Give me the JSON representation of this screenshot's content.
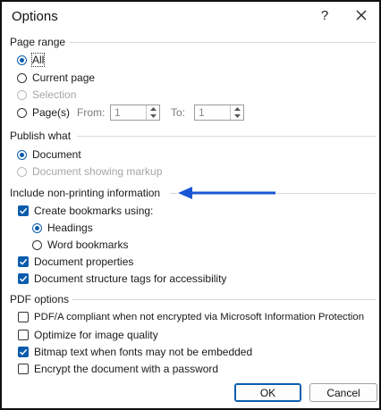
{
  "window": {
    "title": "Options",
    "help_glyph": "?"
  },
  "page_range": {
    "heading": "Page range",
    "all": "All",
    "current_page": "Current page",
    "selection": "Selection",
    "pages": "Page(s)",
    "from_label": "From:",
    "from_value": "1",
    "to_label": "To:",
    "to_value": "1",
    "selected": "all"
  },
  "publish_what": {
    "heading": "Publish what",
    "document": "Document",
    "document_markup": "Document showing markup",
    "selected": "document"
  },
  "non_printing": {
    "heading": "Include non-printing information",
    "create_bookmarks": "Create bookmarks using:",
    "create_bookmarks_checked": true,
    "headings": "Headings",
    "word_bookmarks": "Word bookmarks",
    "bookmark_source": "headings",
    "doc_properties": "Document properties",
    "doc_properties_checked": true,
    "structure_tags": "Document structure tags for accessibility",
    "structure_tags_checked": true
  },
  "pdf_options": {
    "heading": "PDF options",
    "pdfa": "PDF/A compliant when not encrypted via Microsoft Information Protection",
    "pdfa_checked": false,
    "optimize": "Optimize for image quality",
    "optimize_checked": false,
    "bitmap": "Bitmap text when fonts may not be embedded",
    "bitmap_checked": true,
    "encrypt": "Encrypt the document with a password",
    "encrypt_checked": false
  },
  "buttons": {
    "ok": "OK",
    "cancel": "Cancel"
  },
  "colors": {
    "accent": "#0b5cad",
    "annotation_arrow": "#1a56d6"
  }
}
